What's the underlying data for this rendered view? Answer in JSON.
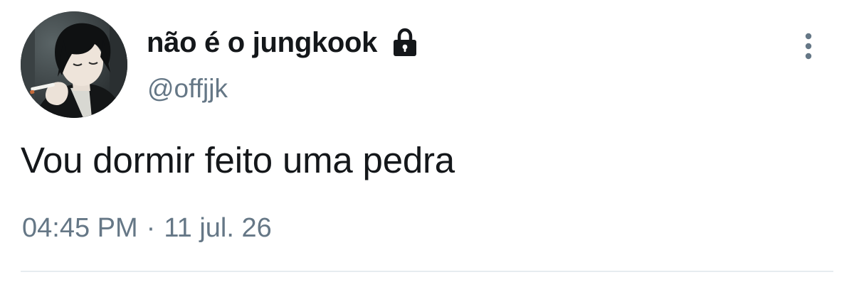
{
  "tweet": {
    "author": {
      "display_name": "não é o jungkook",
      "handle": "@offjjk",
      "protected_icon": "lock-icon",
      "avatar_icon": "avatar-image"
    },
    "text": "Vou dormir feito uma pedra",
    "time": "04:45 PM",
    "separator": "·",
    "date": "11 jul. 26",
    "more_icon": "more-vertical-icon"
  },
  "colors": {
    "primary_text": "#14171a",
    "secondary_text": "#657786",
    "divider": "#e6ecf0",
    "background": "#ffffff"
  }
}
